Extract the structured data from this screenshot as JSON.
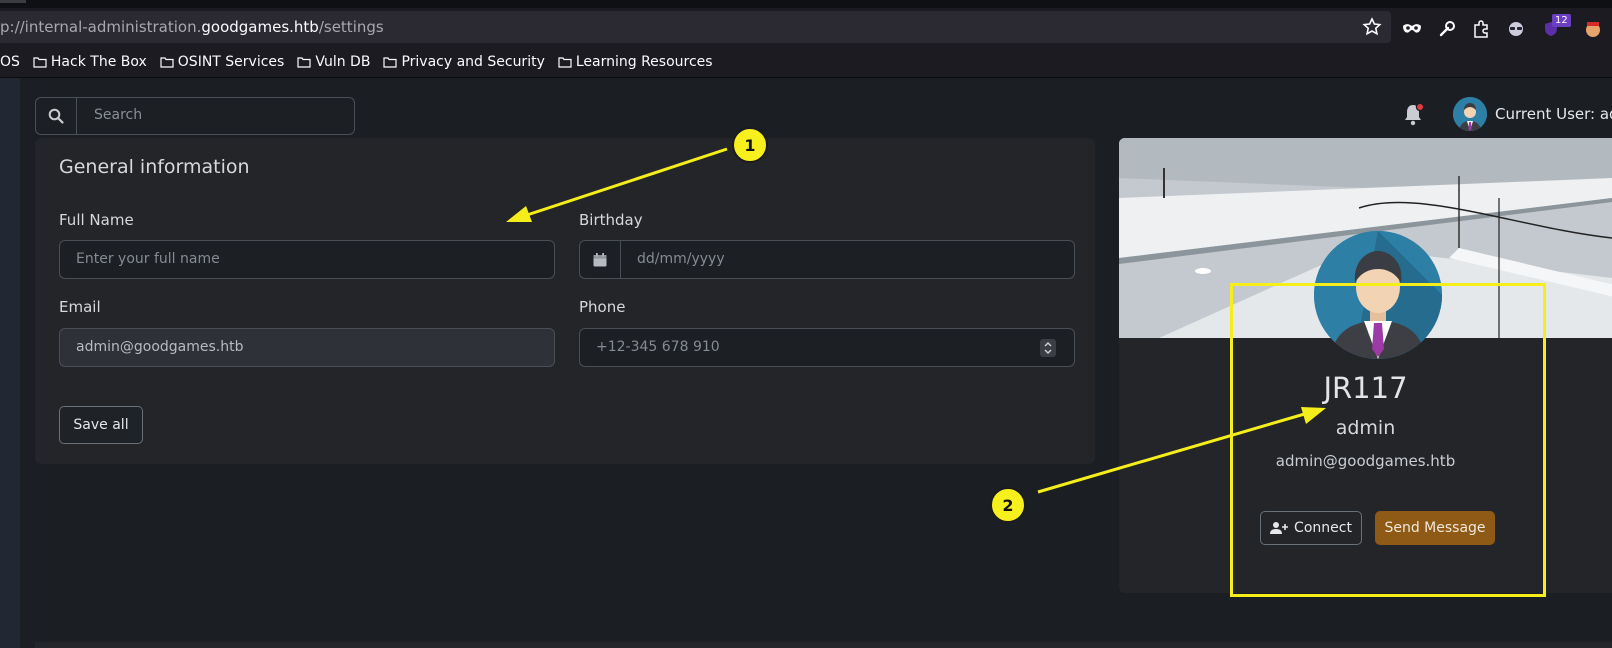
{
  "browser": {
    "url_prefix": "p://internal-administration.",
    "url_host": "goodgames.htb",
    "url_path": "/settings",
    "extension_badge": "12",
    "bookmarks": [
      "OS",
      "Hack The Box",
      "OSINT Services",
      "Vuln DB",
      "Privacy and Security",
      "Learning Resources"
    ]
  },
  "header": {
    "search_placeholder": "Search",
    "user_label": "Current User: adm"
  },
  "general_info": {
    "title": "General information",
    "full_name_label": "Full Name",
    "full_name_placeholder": "Enter your full name",
    "birthday_label": "Birthday",
    "birthday_placeholder": "dd/mm/yyyy",
    "email_label": "Email",
    "email_value": "admin@goodgames.htb",
    "phone_label": "Phone",
    "phone_placeholder": "+12-345 678 910",
    "save_label": "Save all"
  },
  "profile": {
    "name": "JR117",
    "role": "admin",
    "email": "admin@goodgames.htb",
    "connect_label": "Connect",
    "send_label": "Send Message"
  },
  "annotations": {
    "marker1": "1",
    "marker2": "2",
    "color": "#f5ee1a"
  },
  "colors": {
    "page_bg": "#1b1e22",
    "card_bg": "#232528",
    "send_button": "#8e5a15"
  }
}
